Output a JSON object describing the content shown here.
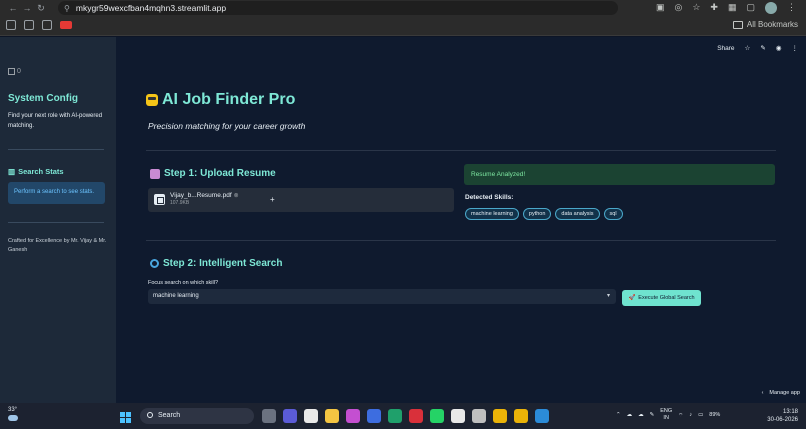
{
  "browser": {
    "url": "mkygr59wexcfban4mqhn3.streamlit.app",
    "all_bookmarks": "All Bookmarks"
  },
  "sidebar": {
    "image_alt": "0",
    "title": "System Config",
    "description": "Find your next role with AI-powered matching.",
    "stats_title": "Search Stats",
    "stats_info": "Perform a search to see stats.",
    "credit": "Crafted for Excellence by Mr. Vijay & Mr. Ganesh"
  },
  "topbar": {
    "share": "Share"
  },
  "main": {
    "title": "AI Job Finder Pro",
    "subtitle": "Precision matching for your career growth",
    "step1": {
      "heading": "Step 1: Upload Resume",
      "file_name": "Vijay_b...Resume.pdf",
      "file_size": "107.9KB"
    },
    "analysis": {
      "status": "Resume Analyzed!",
      "detected_label": "Detected Skills:",
      "skills": [
        "machine learning",
        "python",
        "data analysis",
        "sql"
      ]
    },
    "step2": {
      "heading": "Step 2: Intelligent Search",
      "focus_label": "Focus search on which skill?",
      "selected_skill": "machine learning",
      "execute_button": "Execute Global Search"
    },
    "manage_app": "Manage app"
  },
  "taskbar": {
    "temperature": "33°",
    "search_placeholder": "Search",
    "language": "ENG",
    "region": "IN",
    "battery": "89%",
    "time": "13:18",
    "date": "30-06-2026"
  }
}
